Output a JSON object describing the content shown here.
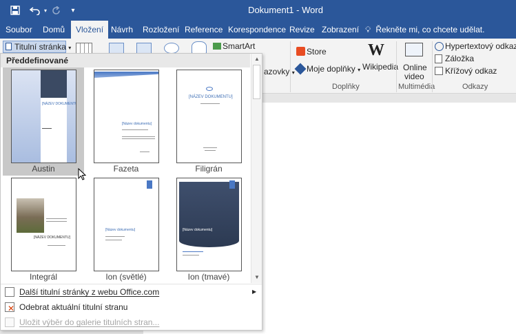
{
  "title_bar": {
    "document_title": "Dokument1 - Word",
    "quick_access": [
      "save-icon",
      "undo-icon",
      "redo-icon",
      "customize-icon"
    ]
  },
  "tabs": [
    "Soubor",
    "Domů",
    "Vložení",
    "Návrh",
    "Rozložení",
    "Reference",
    "Korespondence",
    "Revize",
    "Zobrazení"
  ],
  "active_tab": "Vložení",
  "tell_me": "Řekněte mi, co chcete udělat.",
  "ribbon": {
    "cover_page_button": "Titulní stránka",
    "smartart": "SmartArt",
    "partial_label": "azovky",
    "store": "Store",
    "my_addins": "Moje doplňky",
    "wikipedia": "Wikipedia",
    "online_video_1": "Online",
    "online_video_2": "video",
    "hyperlink": "Hypertextový odkaz",
    "bookmark": "Záložka",
    "cross_ref": "Křížový odkaz",
    "groups": {
      "addins": "Doplňky",
      "media": "Multimédia",
      "links": "Odkazy"
    }
  },
  "gallery": {
    "header": "Předdefinované",
    "templates": [
      {
        "name": "Austin",
        "selected": true
      },
      {
        "name": "Fazeta",
        "selected": false
      },
      {
        "name": "Filigrán",
        "selected": false
      },
      {
        "name": "Integrál",
        "selected": false
      },
      {
        "name": "Ion (světlé)",
        "selected": false
      },
      {
        "name": "Ion (tmavé)",
        "selected": false
      }
    ],
    "thumb_texts": {
      "nazev_doc": "[Název dokumentu]",
      "nazev_doc_caps": "[NÁZEV DOKUMENTU]",
      "podtitul": "[Podtitul dokumentu]"
    },
    "menu": [
      {
        "label": "Další titulní stránky z webu Office.com",
        "enabled": true,
        "has_submenu": true
      },
      {
        "label": "Odebrat aktuální titulní stranu",
        "enabled": true,
        "has_submenu": false
      },
      {
        "label": "Uložit výběr do galerie titulních stran...",
        "enabled": false,
        "has_submenu": false
      }
    ]
  },
  "colors": {
    "brand": "#2b579a",
    "accent_light": "#4a78c4"
  }
}
